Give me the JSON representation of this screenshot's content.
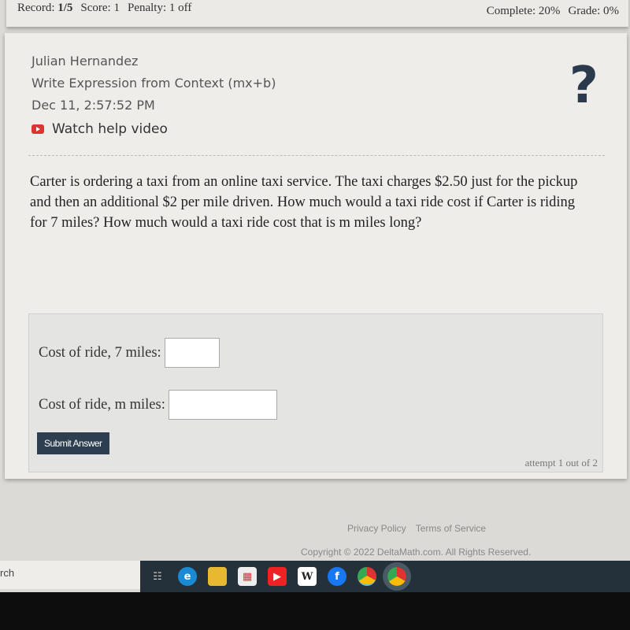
{
  "topbar": {
    "record_label": "Record:",
    "record": "1/5",
    "score": "Score: 1",
    "penalty": "Penalty: 1 off",
    "complete": "Complete: 20%",
    "grade": "Grade: 0%"
  },
  "problem": {
    "student": "Julian Hernandez",
    "skill": "Write Expression from Context (mx+b)",
    "timestamp": "Dec 11, 2:57:52 PM",
    "help_video": "Watch help video",
    "help_icon": "?",
    "question": "Carter is ordering a taxi from an online taxi service. The taxi charges $2.50 just for the pickup and then an additional $2 per mile driven. How much would a taxi ride cost if Carter is riding for 7 miles? How much would a taxi ride cost that is m miles long?"
  },
  "answers": {
    "label_7": "Cost of ride, 7 miles:",
    "label_m": "Cost of ride, m miles:",
    "value_7": "",
    "value_m": "",
    "submit": "Submit Answer",
    "attempt": "attempt 1 out of 2"
  },
  "footer": {
    "privacy": "Privacy Policy",
    "terms": "Terms of Service",
    "copyright": "Copyright © 2022 DeltaMath.com. All Rights Reserved."
  },
  "taskbar": {
    "search": "rch",
    "icons": [
      "task-view-icon",
      "edge-icon",
      "file-explorer-icon",
      "store-icon",
      "youtube-icon",
      "wikipedia-icon",
      "facebook-icon",
      "chrome-icon",
      "chrome-profile-icon"
    ]
  }
}
